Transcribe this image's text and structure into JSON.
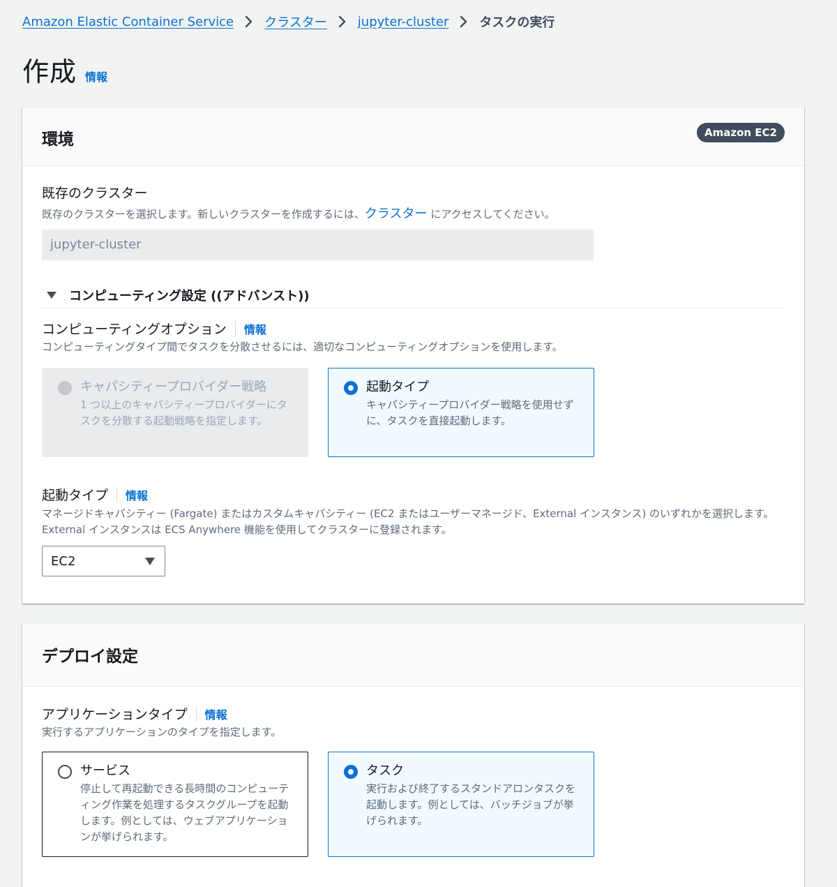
{
  "breadcrumb": {
    "items": [
      "Amazon Elastic Container Service",
      "クラスター",
      "jupyter-cluster"
    ],
    "current": "タスクの実行"
  },
  "page": {
    "title": "作成",
    "info": "情報"
  },
  "environment": {
    "title": "環境",
    "badge": "Amazon EC2",
    "cluster_label": "既存のクラスター",
    "cluster_desc_before": "既存のクラスターを選択します。新しいクラスターを作成するには、",
    "cluster_desc_link": "クラスター",
    "cluster_desc_after": " にアクセスしてください。",
    "cluster_value": "jupyter-cluster",
    "advanced_label": "コンピューティング設定 ((アドバンスト))",
    "compute_option_label": "コンピューティングオプション",
    "compute_option_info": "情報",
    "compute_option_desc": "コンピューティングタイプ間でタスクを分散させるには、適切なコンピューティングオプションを使用します。",
    "compute_options": [
      {
        "title": "キャパシティープロバイダー戦略",
        "desc": "1 つ以上のキャパシティープロバイダーにタスクを分散する起動戦略を指定します。"
      },
      {
        "title": "起動タイプ",
        "desc": "キャパシティープロバイダー戦略を使用せずに、タスクを直接起動します。"
      }
    ],
    "launch_type_label": "起動タイプ",
    "launch_type_info": "情報",
    "launch_type_desc": "マネージドキャパシティー (Fargate) またはカスタムキャパシティー (EC2 またはユーザーマネージド、External インスタンス) のいずれかを選択します。External インスタンスは ECS Anywhere 機能を使用してクラスターに登録されます。",
    "launch_type_value": "EC2"
  },
  "deployment": {
    "title": "デプロイ設定",
    "app_type_label": "アプリケーションタイプ",
    "app_type_info": "情報",
    "app_type_desc": "実行するアプリケーションのタイプを指定します。",
    "app_types": [
      {
        "title": "サービス",
        "desc": "停止して再起動できる長時間のコンピューティング作業を処理するタスクグループを起動します。例としては、ウェブアプリケーションが挙げられます。"
      },
      {
        "title": "タスク",
        "desc": "実行および終了するスタンドアロンタスクを起動します。例としては、バッチジョブが挙げられます。"
      }
    ]
  }
}
